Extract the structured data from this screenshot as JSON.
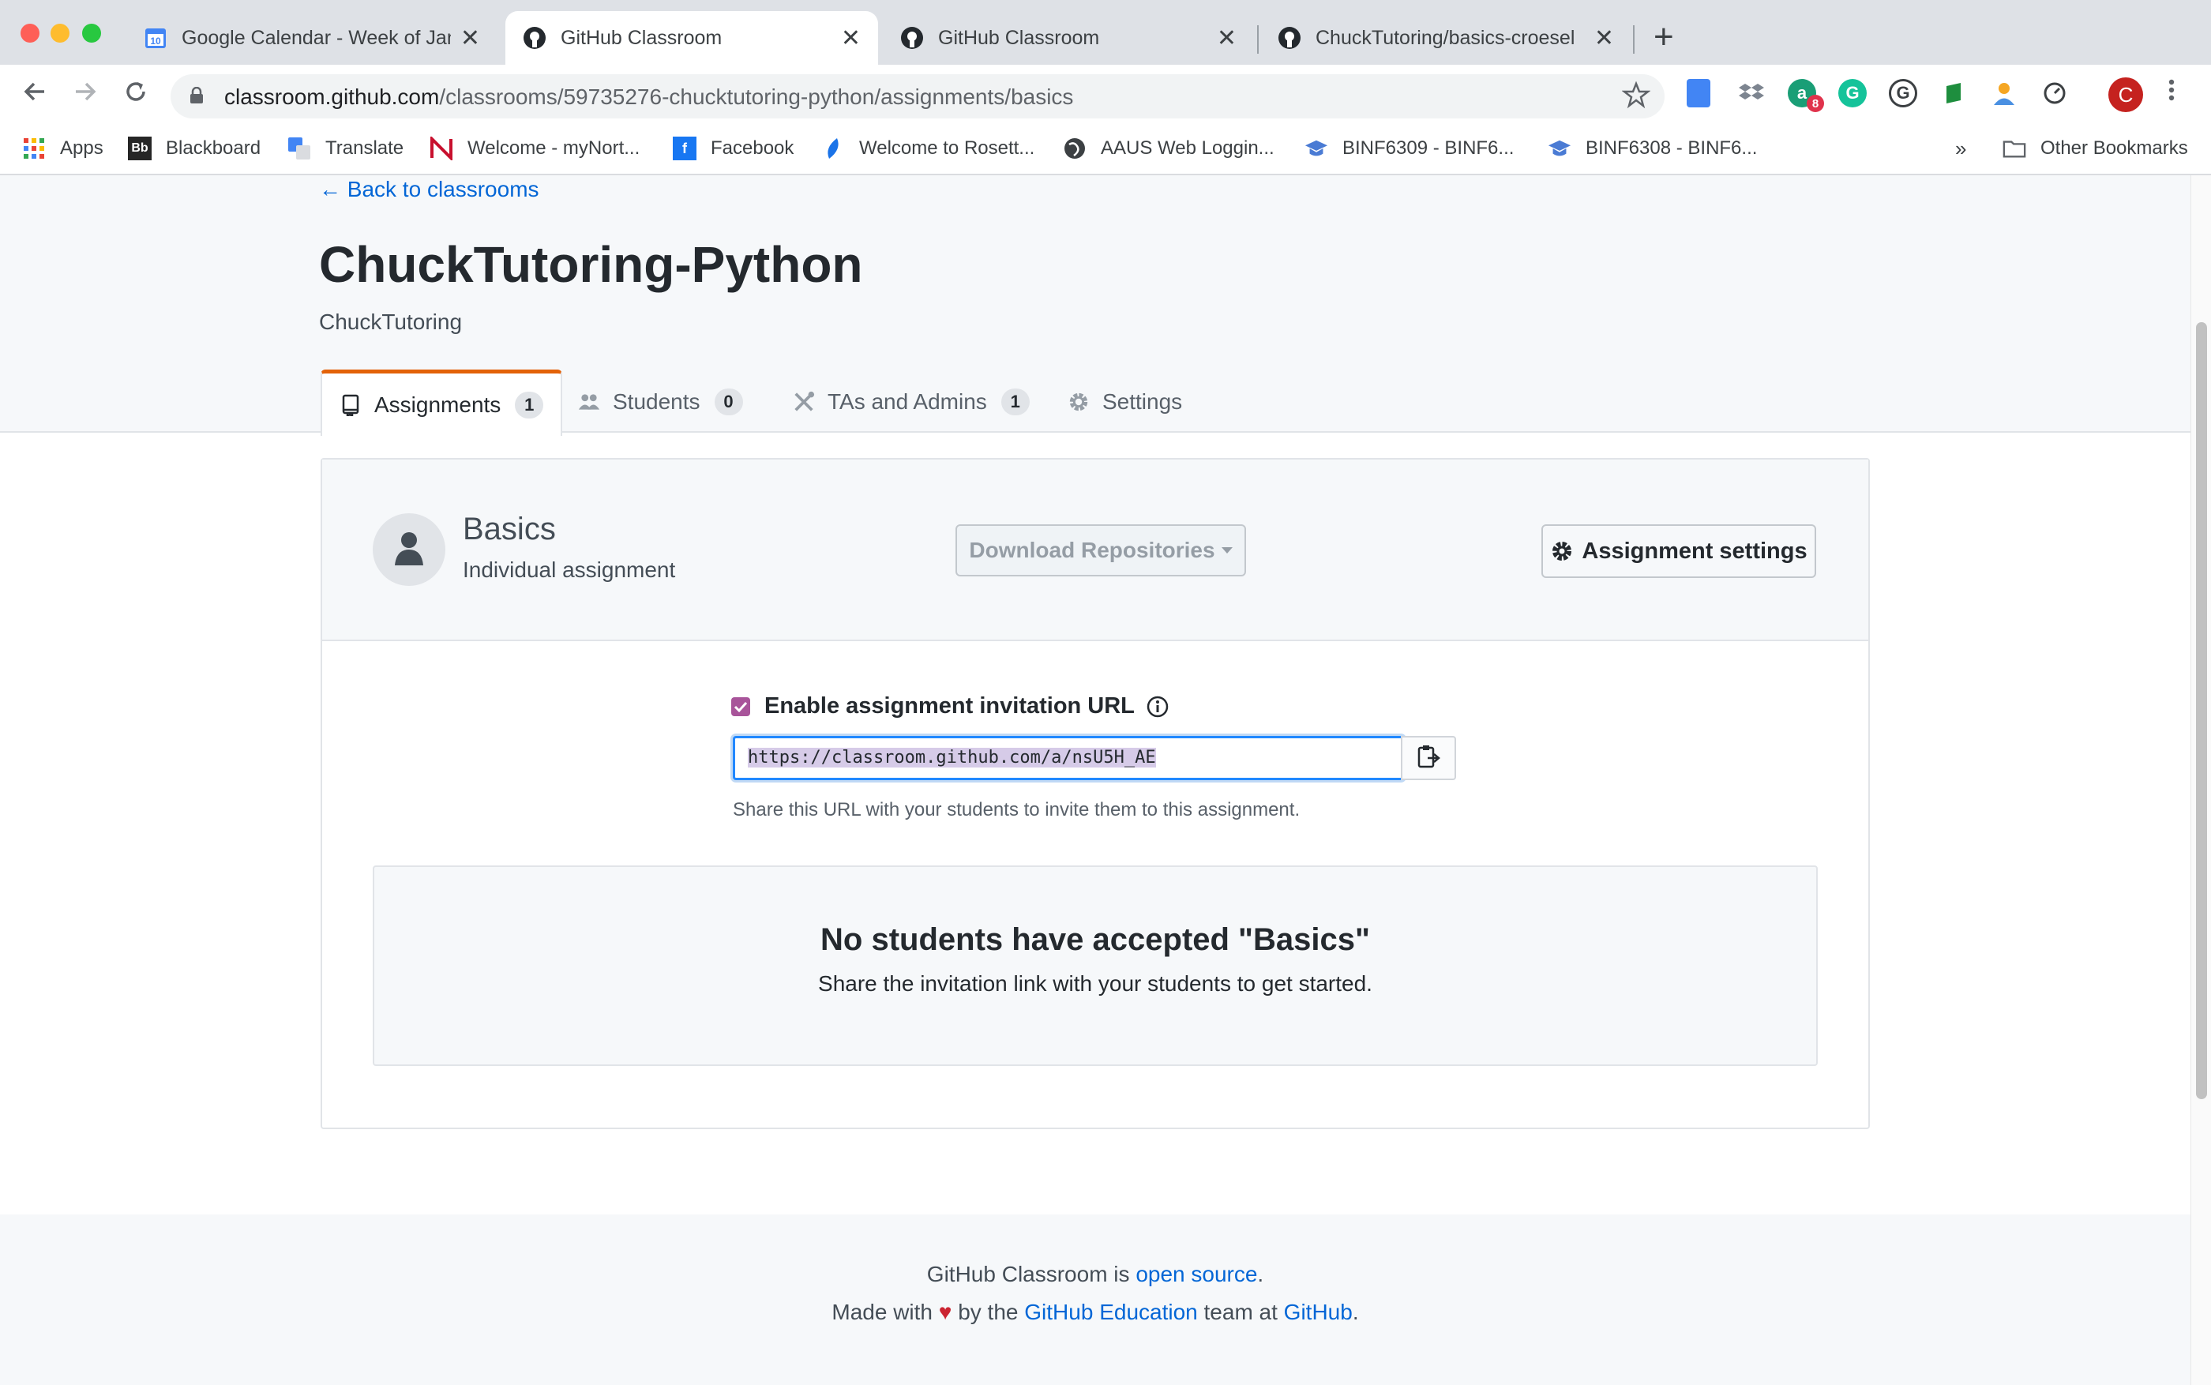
{
  "browser": {
    "tabs": [
      {
        "title": "Google Calendar - Week of Janu",
        "icon": "calendar-icon",
        "icon_text": "10"
      },
      {
        "title": "GitHub Classroom",
        "icon": "github-icon",
        "active": true
      },
      {
        "title": "GitHub Classroom",
        "icon": "github-icon"
      },
      {
        "title": "ChuckTutoring/basics-croesel",
        "icon": "github-icon"
      }
    ],
    "close_glyph": "✕",
    "new_tab_glyph": "+",
    "url_host": "classroom.github.com",
    "url_path": "/classrooms/59735276-chucktutoring-python/assignments/basics",
    "profile_initial": "C",
    "extension_badge": "8",
    "bookmarks": [
      {
        "label": "Apps",
        "icon": "apps-grid-icon"
      },
      {
        "label": "Blackboard",
        "icon": "blackboard-icon",
        "icon_text": "Bb"
      },
      {
        "label": "Translate",
        "icon": "translate-icon"
      },
      {
        "label": "Welcome - myNort...",
        "icon": "northeastern-icon"
      },
      {
        "label": "Facebook",
        "icon": "facebook-icon",
        "icon_text": "f"
      },
      {
        "label": "Welcome to Rosett...",
        "icon": "rosetta-icon"
      },
      {
        "label": "AAUS Web Loggin...",
        "icon": "globe-icon"
      },
      {
        "label": "BINF6309 - BINF6...",
        "icon": "course-icon"
      },
      {
        "label": "BINF6308 - BINF6...",
        "icon": "course-icon"
      }
    ],
    "bookmarks_overflow": "»",
    "other_bookmarks": "Other Bookmarks"
  },
  "page": {
    "back_link": "Back to classrooms",
    "classroom_title": "ChuckTutoring-Python",
    "organization": "ChuckTutoring",
    "tabs": [
      {
        "label": "Assignments",
        "count": "1",
        "icon": "repo-book-icon"
      },
      {
        "label": "Students",
        "count": "0",
        "icon": "people-icon"
      },
      {
        "label": "TAs and Admins",
        "count": "1",
        "icon": "tools-icon"
      },
      {
        "label": "Settings",
        "icon": "gear-icon"
      }
    ]
  },
  "assignment": {
    "name": "Basics",
    "type": "Individual assignment",
    "download_label": "Download Repositories",
    "settings_label": "Assignment settings",
    "invite_label": "Enable assignment invitation URL",
    "invite_enabled": true,
    "invite_url": "https://classroom.github.com/a/nsU5H_AE",
    "invite_help": "Share this URL with your students to invite them to this assignment.",
    "empty_title": "No students have accepted \"Basics\"",
    "empty_subtitle": "Share the invitation link with your students to get started."
  },
  "footer": {
    "line1_prefix": "GitHub Classroom is ",
    "line1_link": "open source",
    "line1_suffix": ".",
    "line2_prefix": "Made with ",
    "line2_mid": " by the ",
    "line2_link1": "GitHub Education",
    "line2_mid2": " team at ",
    "line2_link2": "GitHub",
    "line2_suffix": "."
  },
  "colors": {
    "link": "#0366d6",
    "tab_accent": "#e36209",
    "checkbox": "#a8549a",
    "focus": "#2188ff"
  }
}
